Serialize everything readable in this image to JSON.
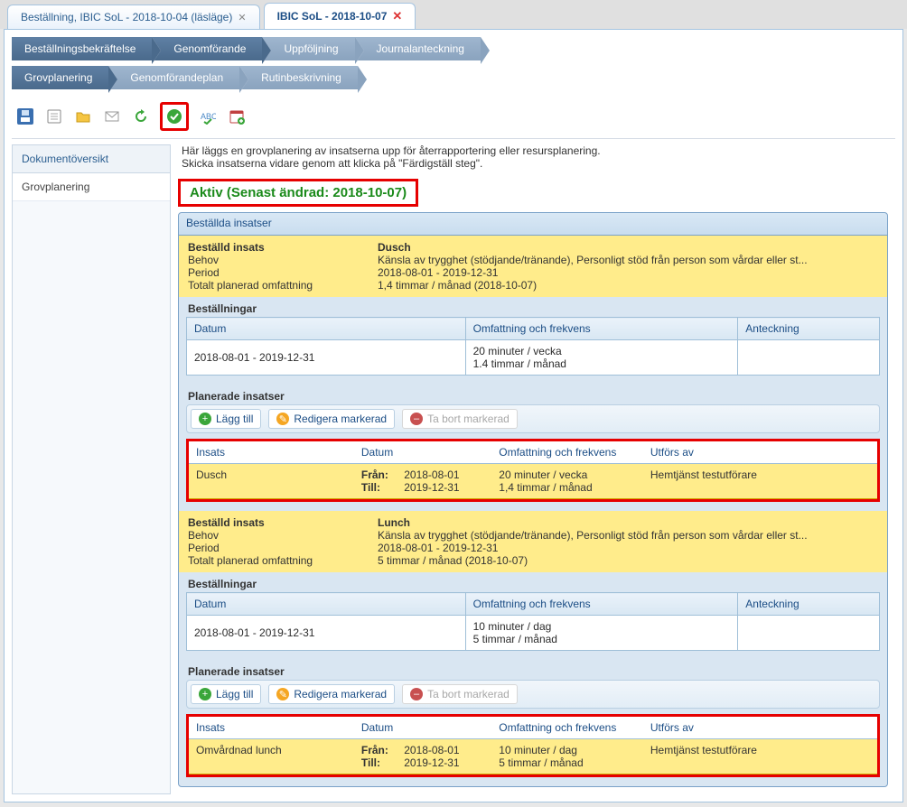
{
  "tabs": {
    "inactive_label": "Beställning, IBIC SoL - 2018-10-04 (läsläge)",
    "active_label": "IBIC SoL - 2018-10-07"
  },
  "crumbs_top": [
    "Beställningsbekräftelse",
    "Genomförande",
    "Uppföljning",
    "Journalanteckning"
  ],
  "crumbs_sub": [
    "Grovplanering",
    "Genomförandeplan",
    "Rutinbeskrivning"
  ],
  "sidebar": {
    "header": "Dokumentöversikt",
    "item1": "Grovplanering"
  },
  "instructions": {
    "line1": "Här läggs en grovplanering av insatserna upp för återrapportering eller resursplanering.",
    "line2": "Skicka insatserna vidare genom att klicka på \"Färdigställ steg\"."
  },
  "status_label": "Aktiv (Senast ändrad: 2018-10-07)",
  "panel_title": "Beställda insatser",
  "labels": {
    "bestalld_insats": "Beställd insats",
    "behov": "Behov",
    "period": "Period",
    "totalt": "Totalt planerad omfattning",
    "bestallningar": "Beställningar",
    "planerade": "Planerade insatser",
    "lagg_till": "Lägg till",
    "redigera": "Redigera markerad",
    "tabort": "Ta bort markerad",
    "datum": "Datum",
    "omf": "Omfattning och frekvens",
    "anteckning": "Anteckning",
    "insats": "Insats",
    "utfors": "Utförs av",
    "fran": "Från:",
    "till": "Till:"
  },
  "item1": {
    "name": "Dusch",
    "behov": "Känsla av trygghet (stödjande/tränande), Personligt stöd från person som vårdar eller st...",
    "period": "2018-08-01  -  2019-12-31",
    "totalt": "1,4 timmar / månad (2018-10-07)",
    "best_datum": "2018-08-01 - 2019-12-31",
    "best_omf1": "20 minuter / vecka",
    "best_omf2": "1.4 timmar / månad",
    "plan_insats": "Dusch",
    "plan_from": "2018-08-01",
    "plan_till": "2019-12-31",
    "plan_omf1": "20 minuter / vecka",
    "plan_omf2": "1,4 timmar / månad",
    "plan_utfors": "Hemtjänst testutförare"
  },
  "item2": {
    "name": "Lunch",
    "behov": "Känsla av trygghet (stödjande/tränande), Personligt stöd från person som vårdar eller st...",
    "period": "2018-08-01  -  2019-12-31",
    "totalt": "5 timmar / månad (2018-10-07)",
    "best_datum": "2018-08-01 - 2019-12-31",
    "best_omf1": "10 minuter / dag",
    "best_omf2": "5 timmar / månad",
    "plan_insats": "Omvårdnad lunch",
    "plan_from": "2018-08-01",
    "plan_till": "2019-12-31",
    "plan_omf1": "10 minuter / dag",
    "plan_omf2": "5 timmar / månad",
    "plan_utfors": "Hemtjänst testutförare"
  }
}
